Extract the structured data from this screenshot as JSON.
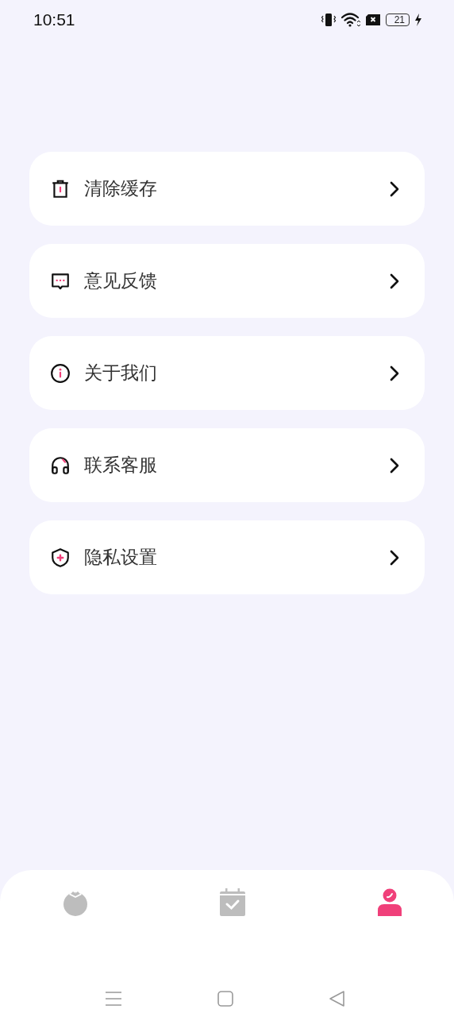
{
  "status_bar": {
    "time": "10:51",
    "battery": "21"
  },
  "menu": [
    {
      "kind": "trash",
      "label": "清除缓存"
    },
    {
      "kind": "chat",
      "label": "意见反馈"
    },
    {
      "kind": "info",
      "label": "关于我们"
    },
    {
      "kind": "headset",
      "label": "联系客服"
    },
    {
      "kind": "shield",
      "label": "隐私设置"
    }
  ],
  "tabs": [
    {
      "kind": "fruit",
      "selected": false
    },
    {
      "kind": "calendar",
      "selected": false
    },
    {
      "kind": "person",
      "selected": true
    }
  ],
  "system_nav": [
    {
      "kind": "menu"
    },
    {
      "kind": "home"
    },
    {
      "kind": "back"
    }
  ]
}
